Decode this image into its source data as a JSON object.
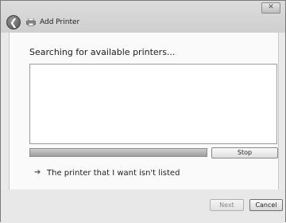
{
  "window": {
    "title": "Add Printer",
    "close_glyph": "✕"
  },
  "header": {
    "back_icon": "back-arrow-icon",
    "printer_icon": "printer-icon"
  },
  "main": {
    "heading": "Searching for available printers...",
    "progress_fraction": 1.0,
    "stop_label": "Stop",
    "link_text": "The printer that I want isn't listed"
  },
  "footer": {
    "next_label": "Next",
    "cancel_label": "Cancel"
  },
  "colors": {
    "window_bg": "#eaeaea",
    "content_bg": "#fafafa",
    "disabled_text": "#8a8a8a"
  }
}
